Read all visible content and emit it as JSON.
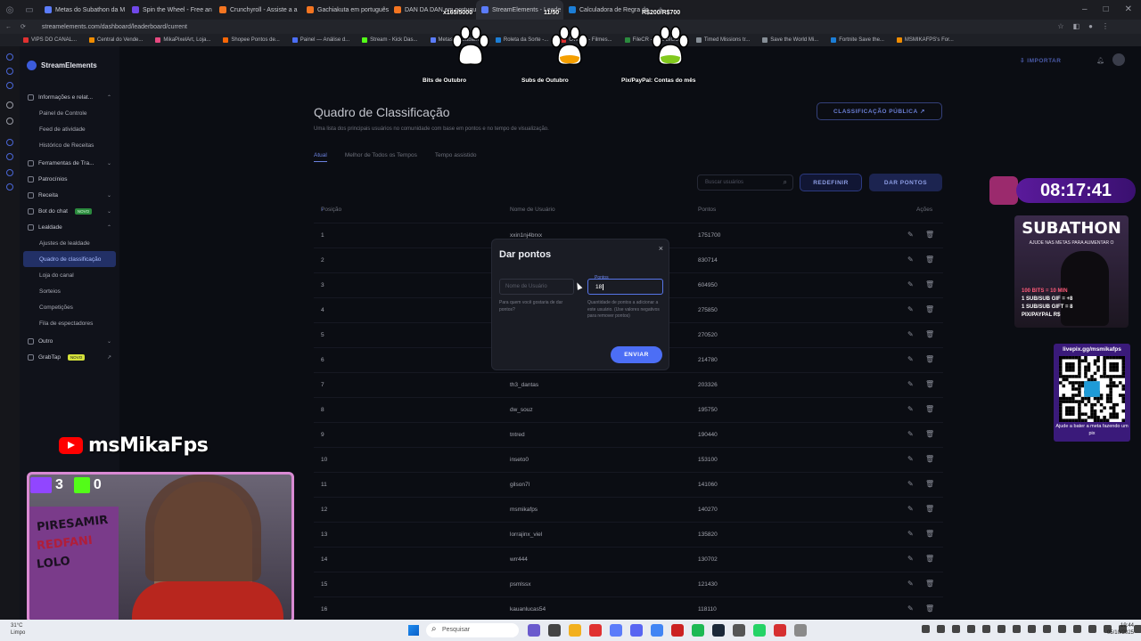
{
  "browser": {
    "tabs": [
      {
        "label": "Metas do Subathon da M",
        "color": "#5b7cfa"
      },
      {
        "label": "Spin the Wheel - Free an",
        "color": "#7048e8"
      },
      {
        "label": "Crunchyroll - Assiste a a",
        "color": "#f47521"
      },
      {
        "label": "Gachiakuta em português",
        "color": "#f47521"
      },
      {
        "label": "DAN DA DAN em portugu",
        "color": "#f47521"
      },
      {
        "label": "StreamElements - Leade",
        "color": "#5b7cfa",
        "active": true
      },
      {
        "label": "Calculadora de Regra de",
        "color": "#1c7ed6"
      }
    ],
    "url": "streamelements.com/dashboard/leaderboard/current",
    "bookmarks": [
      {
        "label": "VIPS DO CANAL...",
        "color": "#e03131"
      },
      {
        "label": "Central do Vende...",
        "color": "#f08c00"
      },
      {
        "label": "MikaPixelArt, Loja...",
        "color": "#e64980"
      },
      {
        "label": "Shopee Pontos de...",
        "color": "#f76707"
      },
      {
        "label": "Painel — Análise d...",
        "color": "#4c6ef5"
      },
      {
        "label": "Stream - Kick Das...",
        "color": "#53fc18"
      },
      {
        "label": "Metas do Subath...",
        "color": "#5b7cfa"
      },
      {
        "label": "Roleta da Sorte -...",
        "color": "#1c7ed6"
      },
      {
        "label": "Overflix - Filmes...",
        "color": "#e03131"
      },
      {
        "label": "FileCR - THE BIGG...",
        "color": "#2b8a3e"
      },
      {
        "label": "Timed Missions tr...",
        "color": "#868e96"
      },
      {
        "label": "Save the World Mi...",
        "color": "#868e96"
      },
      {
        "label": "Fortnite Save the...",
        "color": "#1c7ed6"
      },
      {
        "label": "MSMIKAFPS's For...",
        "color": "#f08c00"
      }
    ]
  },
  "sidebar": {
    "brand": "StreamElements",
    "items": [
      {
        "type": "group",
        "label": "Informações e relat...",
        "chev": "⌃"
      },
      {
        "type": "sub",
        "label": "Painel de Controle"
      },
      {
        "type": "sub",
        "label": "Feed de atividade"
      },
      {
        "type": "sub",
        "label": "Histórico de Receitas"
      },
      {
        "type": "group",
        "label": "Ferramentas de Tra...",
        "chev": "⌄"
      },
      {
        "type": "group",
        "label": "Patrocínios",
        "chev": ""
      },
      {
        "type": "group",
        "label": "Receita",
        "chev": "⌄"
      },
      {
        "type": "group",
        "label": "Bot do chat",
        "badge": "NOVO",
        "chev": "⌄"
      },
      {
        "type": "group",
        "label": "Lealdade",
        "chev": "⌃"
      },
      {
        "type": "sub",
        "label": "Ajustes de lealdade"
      },
      {
        "type": "sub",
        "label": "Quadro de classificação",
        "active": true
      },
      {
        "type": "sub",
        "label": "Loja do canal"
      },
      {
        "type": "sub",
        "label": "Sorteios"
      },
      {
        "type": "sub",
        "label": "Competições"
      },
      {
        "type": "sub",
        "label": "Fila de espectadores"
      },
      {
        "type": "group",
        "label": "Outro",
        "chev": "⌄"
      },
      {
        "type": "group",
        "label": "GrabTap",
        "badge": "NOVO",
        "badgeYellow": true,
        "chev": "↗"
      }
    ]
  },
  "header": {
    "import_label": "IMPORTAR"
  },
  "page": {
    "title": "Quadro de Classificação",
    "subtitle": "Uma lista dos principais usuários no comunidade com base em pontos e no tempo de visualização.",
    "public_button": "CLASSIFICAÇÃO PÚBLICA",
    "tabs": [
      "Atual",
      "Melhor de Todos os Tempos",
      "Tempo assistido"
    ],
    "search_placeholder": "Buscar usuários",
    "reset_button": "REDEFINIR",
    "give_button": "DAR PONTOS",
    "columns": {
      "position": "Posição",
      "username": "Nome de Usuário",
      "points": "Pontos",
      "actions": "Ações"
    },
    "rows": [
      {
        "pos": "1",
        "user": "xxin1nj4brxx",
        "points": "1751700"
      },
      {
        "pos": "2",
        "user": "",
        "points": "830714"
      },
      {
        "pos": "3",
        "user": "",
        "points": "604950"
      },
      {
        "pos": "4",
        "user": "",
        "points": "275850"
      },
      {
        "pos": "5",
        "user": "",
        "points": "270520"
      },
      {
        "pos": "6",
        "user": "",
        "points": "214780"
      },
      {
        "pos": "7",
        "user": "th3_dantas",
        "points": "203326"
      },
      {
        "pos": "8",
        "user": "dw_souz",
        "points": "195750"
      },
      {
        "pos": "9",
        "user": "tntred",
        "points": "190440"
      },
      {
        "pos": "10",
        "user": "inseto0",
        "points": "153100"
      },
      {
        "pos": "11",
        "user": "gilson7l",
        "points": "141060"
      },
      {
        "pos": "12",
        "user": "msmikafps",
        "points": "140270"
      },
      {
        "pos": "13",
        "user": "lorrajinx_viel",
        "points": "135820"
      },
      {
        "pos": "14",
        "user": "wrr444",
        "points": "130702"
      },
      {
        "pos": "15",
        "user": "psmlssx",
        "points": "121430"
      },
      {
        "pos": "16",
        "user": "kauanlucas54",
        "points": "118110"
      }
    ]
  },
  "modal": {
    "title": "Dar pontos",
    "close": "×",
    "username_placeholder": "Nome de Usuário",
    "points_label": "Pontos",
    "points_value": "18",
    "help_user": "Para quem você gostaria de dar pontos?",
    "help_points": "Quantidade de pontos a adicionar a este usuário. (Use valores negativos para remover pontos)",
    "send": "ENVIAR"
  },
  "overlay": {
    "goals": [
      {
        "value": "x165/5000",
        "label": "Bits de Outubro",
        "fill": "#ffffff"
      },
      {
        "value": "11/50",
        "label": "Subs de Outubro",
        "fill": "#f59f00"
      },
      {
        "value": "R$200/R$700",
        "label": "Pix/PayPal: Contas do mês",
        "fill": "#82c91e"
      }
    ],
    "timer": "08:17:41",
    "subathon": {
      "title": "SUBATHON",
      "subtitle": "AJUDE NAS METAS PARA AUMENTAR O",
      "rules": [
        "100 BITS = 10 MIN",
        "1 SUB/SUB GIF = +8",
        "1 SUB/SUB GIFT = 8",
        "PIX/PAYPAL R$"
      ]
    },
    "pix": {
      "title": "livepix.gg/msmikafps",
      "caption": "Ajude a bater a meta fazendo um pix"
    },
    "channel": "msMikaFps",
    "twitch_count": "3",
    "kick_count": "0",
    "poster_lines": [
      "PIRESAMIR",
      "REDFANI",
      "LOLO"
    ]
  },
  "taskbar": {
    "weather_temp": "31°C",
    "weather_desc": "Limpo",
    "search": "Pesquisar",
    "time": "19:44",
    "date": "05/10/2025"
  }
}
